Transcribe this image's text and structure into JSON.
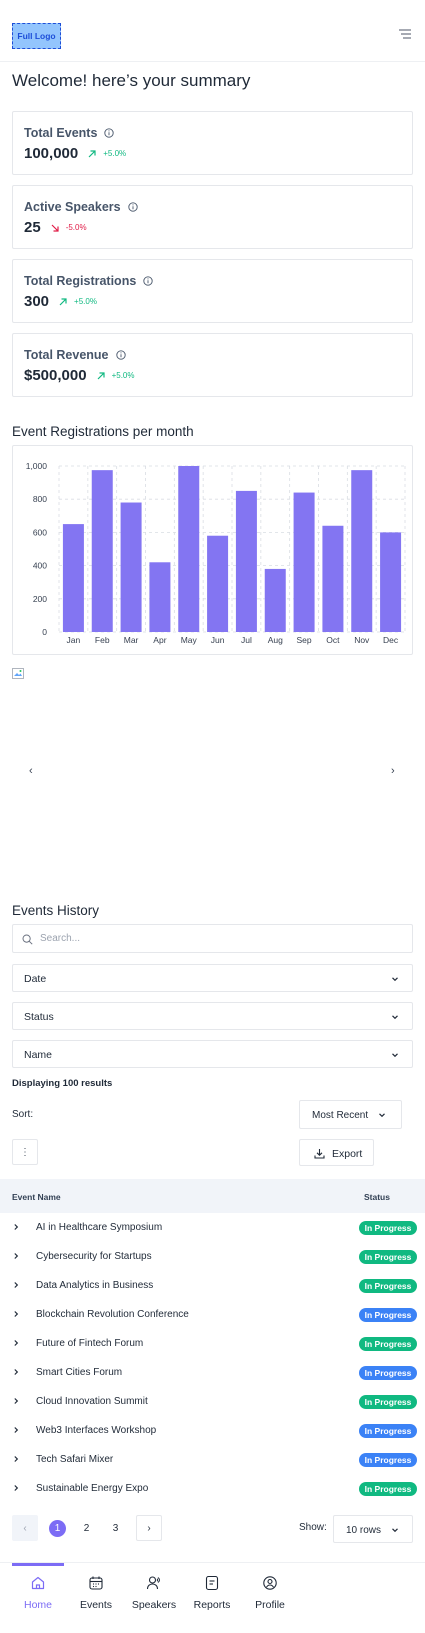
{
  "header": {
    "logo_text": "Full Logo",
    "menu_icon": "filter-lines-icon"
  },
  "welcome": "Welcome! here’s your summary",
  "stats": [
    {
      "title": "Total Events",
      "value": "100,000",
      "change": "+5.0%",
      "trend": "up"
    },
    {
      "title": "Active Speakers",
      "value": "25",
      "change": "-5.0%",
      "trend": "down"
    },
    {
      "title": "Total Registrations",
      "value": "300",
      "change": "+5.0%",
      "trend": "up"
    },
    {
      "title": "Total Revenue",
      "value": "$500,000",
      "change": "+5.0%",
      "trend": "up"
    }
  ],
  "chart_section_title": "Event Registrations per month",
  "chart_data": {
    "type": "bar",
    "title": "Event Registrations per month",
    "categories": [
      "Jan",
      "Feb",
      "Mar",
      "Apr",
      "May",
      "Jun",
      "Jul",
      "Aug",
      "Sep",
      "Oct",
      "Nov",
      "Dec"
    ],
    "values": [
      650,
      975,
      780,
      420,
      1000,
      580,
      850,
      380,
      840,
      640,
      975,
      600
    ],
    "ylim": [
      0,
      1000
    ],
    "yticks": [
      "0",
      "200",
      "400",
      "600",
      "800",
      "1,000"
    ],
    "grid": true,
    "bar_color": "#8375f2"
  },
  "carousel": {
    "prev_label": "‹",
    "next_label": "›"
  },
  "events_history": {
    "title": "Events History",
    "search_placeholder": "Search...",
    "filters": [
      "Date",
      "Status",
      "Name"
    ],
    "results_text": "Displaying 100 results",
    "sort_label": "Sort:",
    "sort_value": "Most Recent",
    "more_label": "⋮",
    "export_label": "Export",
    "columns": {
      "name": "Event Name",
      "status": "Status"
    },
    "rows": [
      {
        "name": "AI in Healthcare Symposium",
        "status": "In Progress",
        "color": "#10b981"
      },
      {
        "name": "Cybersecurity for Startups",
        "status": "In Progress",
        "color": "#10b981"
      },
      {
        "name": "Data Analytics in Business",
        "status": "In Progress",
        "color": "#10b981"
      },
      {
        "name": "Blockchain Revolution Conference",
        "status": "In Progress",
        "color": "#3b82f6"
      },
      {
        "name": "Future of Fintech Forum",
        "status": "In Progress",
        "color": "#10b981"
      },
      {
        "name": "Smart Cities Forum",
        "status": "In Progress",
        "color": "#3b82f6"
      },
      {
        "name": "Cloud Innovation Summit",
        "status": "In Progress",
        "color": "#10b981"
      },
      {
        "name": "Web3 Interfaces Workshop",
        "status": "In Progress",
        "color": "#3b82f6"
      },
      {
        "name": "Tech Safari Mixer",
        "status": "In Progress",
        "color": "#3b82f6"
      },
      {
        "name": "Sustainable Energy Expo",
        "status": "In Progress",
        "color": "#10b981"
      }
    ],
    "pagination": {
      "prev": "‹",
      "pages": [
        "1",
        "2",
        "3"
      ],
      "current": "1",
      "next": "›",
      "show_label": "Show:",
      "rows_value": "10 rows"
    }
  },
  "bottom_nav": [
    {
      "label": "Home",
      "icon": "home-icon",
      "active": true
    },
    {
      "label": "Events",
      "icon": "calendar-icon",
      "active": false
    },
    {
      "label": "Speakers",
      "icon": "speaker-user-icon",
      "active": false
    },
    {
      "label": "Reports",
      "icon": "report-icon",
      "active": false
    },
    {
      "label": "Profile",
      "icon": "profile-icon",
      "active": false
    }
  ],
  "colors": {
    "accent": "#7c6cf5",
    "up": "#10b981",
    "down": "#e11d48",
    "badge_green": "#10b981",
    "badge_blue": "#3b82f6"
  }
}
